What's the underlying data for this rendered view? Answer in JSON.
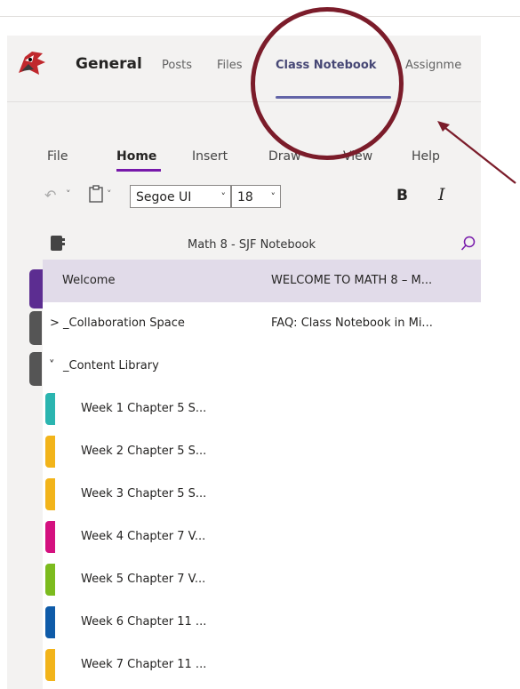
{
  "teams": {
    "channel": "General",
    "tabs": [
      "Posts",
      "Files",
      "Class Notebook",
      "Assignme"
    ],
    "active_tab": "Class Notebook"
  },
  "ribbon": {
    "tabs": [
      "File",
      "Home",
      "Insert",
      "Draw",
      "View",
      "Help"
    ],
    "active_tab": "Home",
    "font_name": "Segoe UI",
    "font_size": "18",
    "bold_label": "B",
    "italic_label": "I"
  },
  "notebook": {
    "title": "Math 8 - SJF Notebook",
    "sections": [
      {
        "label": "Welcome",
        "prefix": "",
        "color": "#5c2d91",
        "selected": true
      },
      {
        "label": "_Collaboration Space",
        "prefix": ">",
        "color": "",
        "selected": false
      },
      {
        "label": "_Content Library",
        "prefix": "˅",
        "color": "",
        "selected": false
      },
      {
        "label": "Week 1 Chapter 5 S...",
        "prefix": "",
        "color": "#2bb5b0",
        "selected": false
      },
      {
        "label": "Week 2 Chapter 5 S...",
        "prefix": "",
        "color": "#f2b41a",
        "selected": false
      },
      {
        "label": "Week 3 Chapter 5 S...",
        "prefix": "",
        "color": "#f2b41a",
        "selected": false
      },
      {
        "label": "Week 4 Chapter 7 V...",
        "prefix": "",
        "color": "#d4117f",
        "selected": false
      },
      {
        "label": "Week 5 Chapter 7 V...",
        "prefix": "",
        "color": "#7cbb1e",
        "selected": false
      },
      {
        "label": "Week 6 Chapter 11 ...",
        "prefix": "",
        "color": "#0f5ba8",
        "selected": false
      },
      {
        "label": "Week 7 Chapter 11 ...",
        "prefix": "",
        "color": "#f2b41a",
        "selected": false
      }
    ],
    "pages": [
      {
        "label": "WELCOME TO MATH 8 – M...",
        "selected": true
      },
      {
        "label": "FAQ: Class Notebook in Mi...",
        "selected": false
      }
    ]
  },
  "colors": {
    "accent": "#6264a7",
    "onenote": "#7719aa",
    "annotation": "#7b1c2a"
  }
}
